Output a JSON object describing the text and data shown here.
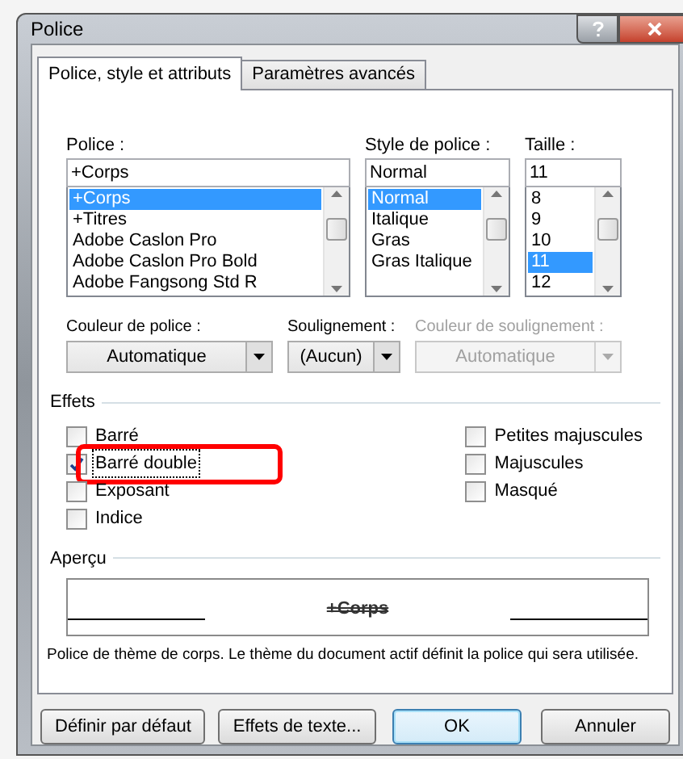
{
  "window": {
    "title": "Police"
  },
  "tabs": [
    {
      "label": "Police, style et attributs",
      "selected": true
    },
    {
      "label": "Paramètres avancés",
      "selected": false
    }
  ],
  "font": {
    "label": "Police :",
    "value": "+Corps",
    "items": [
      {
        "label": "+Corps",
        "selected": true
      },
      {
        "label": "+Titres",
        "selected": false
      },
      {
        "label": "Adobe Caslon Pro",
        "selected": false
      },
      {
        "label": "Adobe Caslon Pro Bold",
        "selected": false
      },
      {
        "label": "Adobe Fangsong Std R",
        "selected": false
      }
    ]
  },
  "style": {
    "label": "Style de police :",
    "value": "Normal",
    "items": [
      {
        "label": "Normal",
        "selected": true
      },
      {
        "label": "Italique",
        "selected": false
      },
      {
        "label": "Gras",
        "selected": false
      },
      {
        "label": "Gras Italique",
        "selected": false
      }
    ]
  },
  "size": {
    "label": "Taille :",
    "value": "11",
    "items": [
      {
        "label": "8",
        "selected": false
      },
      {
        "label": "9",
        "selected": false
      },
      {
        "label": "10",
        "selected": false
      },
      {
        "label": "11",
        "selected": true
      },
      {
        "label": "12",
        "selected": false
      }
    ]
  },
  "dropdowns": [
    {
      "label": "Couleur de police :",
      "value": "Automatique",
      "disabled": false
    },
    {
      "label": "Soulignement :",
      "value": "(Aucun)",
      "disabled": false
    },
    {
      "label": "Couleur de soulignement :",
      "value": "Automatique",
      "disabled": true
    }
  ],
  "effects": {
    "title": "Effets",
    "left": [
      {
        "label": "Barré",
        "checked": false,
        "highlighted": false
      },
      {
        "label": "Barré double",
        "checked": true,
        "highlighted": true
      },
      {
        "label": "Exposant",
        "checked": false,
        "highlighted": false
      },
      {
        "label": "Indice",
        "checked": false,
        "highlighted": false
      }
    ],
    "right": [
      {
        "label": "Petites majuscules",
        "checked": false,
        "highlighted": false
      },
      {
        "label": "Majuscules",
        "checked": false,
        "highlighted": false
      },
      {
        "label": "Masqué",
        "checked": false,
        "highlighted": false
      }
    ]
  },
  "preview": {
    "title": "Aperçu",
    "sample": "+Corps",
    "description": "Police de thème de corps. Le thème du document actif définit la police qui sera utilisée."
  },
  "buttons_left": [
    {
      "label": "Définir par défaut",
      "kind": "normal"
    },
    {
      "label": "Effets de texte...",
      "kind": "normal"
    }
  ],
  "buttons_right": [
    {
      "label": "OK",
      "kind": "default"
    },
    {
      "label": "Annuler",
      "kind": "normal"
    }
  ]
}
